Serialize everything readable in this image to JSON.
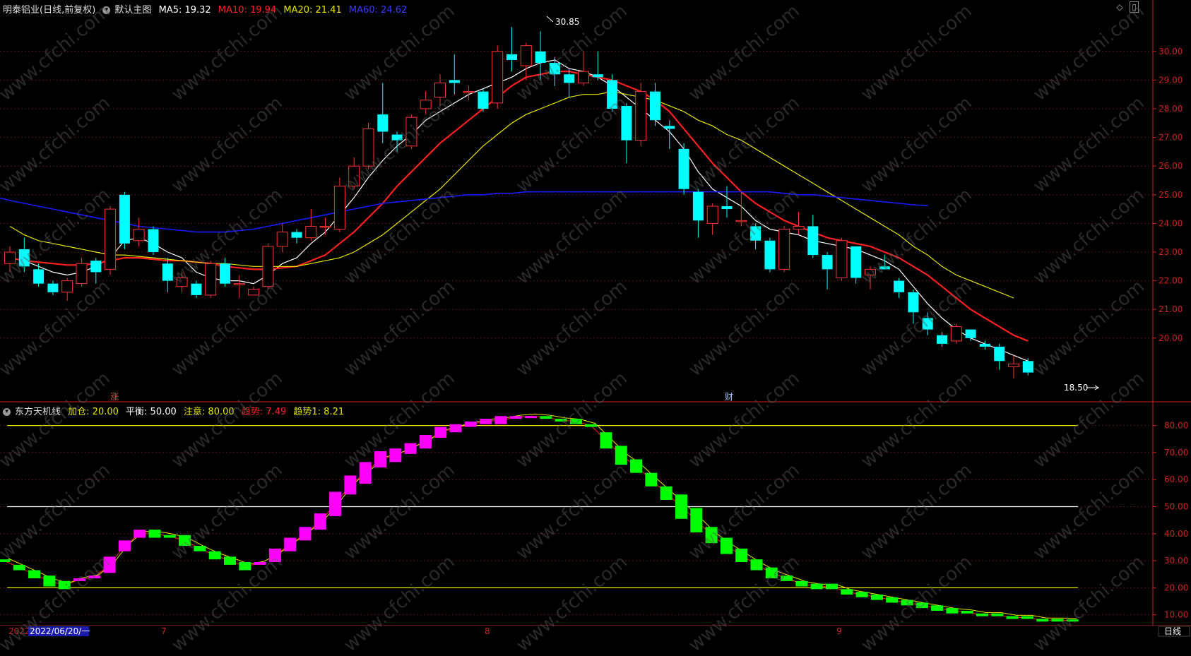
{
  "upper_header": {
    "title": "明泰铝业(日线,前复权)",
    "template": "默认主图",
    "ma5": "MA5: 19.32",
    "ma10": "MA10: 19.94",
    "ma20": "MA20: 21.41",
    "ma60": "MA60: 24.62"
  },
  "lower_header": {
    "title": "东方天机线",
    "jiacang": "加仓: 20.00",
    "pingheng": "平衡: 50.00",
    "zhuyi": "注意: 80.00",
    "qushi": "趋势: 7.49",
    "qushi1": "趋势1: 8.21"
  },
  "markers": {
    "zhang": "涨",
    "cai": "财",
    "high": "30.85",
    "low": "18.50"
  },
  "bottom_bar": {
    "year": "2022",
    "date": "2022/06/20/一",
    "m7": "7",
    "m8": "8",
    "m9": "9",
    "period": "日线"
  },
  "colors": {
    "up": "#ff3232",
    "down": "#00ffff",
    "ma5": "#ffffff",
    "ma10": "#ff2020",
    "ma20": "#e6e600",
    "ma60": "#1a1aff",
    "osc_up": "#ff00ff",
    "osc_down": "#00ff00",
    "axis": "#cc2222"
  },
  "chart_data": [
    {
      "type": "candlestick",
      "title": "明泰铝业(日线,前复权)",
      "y_ticks": [
        "20.00",
        "21.00",
        "22.00",
        "23.00",
        "24.00",
        "25.00",
        "26.00",
        "27.00",
        "28.00",
        "29.00",
        "30.00"
      ],
      "ylim": [
        18.0,
        31.3
      ],
      "candles": [
        {
          "o": 22.6,
          "c": 23.0,
          "h": 23.2,
          "l": 22.3
        },
        {
          "o": 23.1,
          "c": 22.5,
          "h": 23.5,
          "l": 22.3
        },
        {
          "o": 22.4,
          "c": 21.9,
          "h": 22.6,
          "l": 21.8
        },
        {
          "o": 21.9,
          "c": 21.6,
          "h": 22.0,
          "l": 21.5
        },
        {
          "o": 21.6,
          "c": 22.0,
          "h": 22.1,
          "l": 21.3
        },
        {
          "o": 21.9,
          "c": 22.6,
          "h": 22.8,
          "l": 21.8
        },
        {
          "o": 22.7,
          "c": 22.3,
          "h": 22.8,
          "l": 21.9
        },
        {
          "o": 22.4,
          "c": 24.5,
          "h": 24.6,
          "l": 22.2
        },
        {
          "o": 25.0,
          "c": 23.3,
          "h": 25.1,
          "l": 23.1
        },
        {
          "o": 23.4,
          "c": 23.8,
          "h": 24.2,
          "l": 23.2
        },
        {
          "o": 23.8,
          "c": 23.0,
          "h": 23.9,
          "l": 22.9
        },
        {
          "o": 22.6,
          "c": 22.0,
          "h": 22.8,
          "l": 21.6
        },
        {
          "o": 21.8,
          "c": 22.1,
          "h": 22.3,
          "l": 21.6
        },
        {
          "o": 21.9,
          "c": 21.5,
          "h": 22.0,
          "l": 21.4
        },
        {
          "o": 21.5,
          "c": 22.6,
          "h": 22.7,
          "l": 21.4
        },
        {
          "o": 22.6,
          "c": 21.9,
          "h": 22.8,
          "l": 21.8
        },
        {
          "o": 21.9,
          "c": 21.9,
          "h": 22.2,
          "l": 21.4
        },
        {
          "o": 21.5,
          "c": 21.7,
          "h": 21.8,
          "l": 21.5
        },
        {
          "o": 21.8,
          "c": 23.2,
          "h": 23.3,
          "l": 21.7
        },
        {
          "o": 23.2,
          "c": 23.7,
          "h": 24.0,
          "l": 23.0
        },
        {
          "o": 23.7,
          "c": 23.5,
          "h": 23.8,
          "l": 23.3
        },
        {
          "o": 23.5,
          "c": 23.9,
          "h": 24.5,
          "l": 23.4
        },
        {
          "o": 23.9,
          "c": 23.9,
          "h": 24.2,
          "l": 23.6
        },
        {
          "o": 23.8,
          "c": 25.3,
          "h": 25.6,
          "l": 23.7
        },
        {
          "o": 25.3,
          "c": 26.0,
          "h": 26.3,
          "l": 25.2
        },
        {
          "o": 26.0,
          "c": 27.3,
          "h": 27.5,
          "l": 25.9
        },
        {
          "o": 27.8,
          "c": 27.2,
          "h": 28.9,
          "l": 26.8
        },
        {
          "o": 27.1,
          "c": 26.9,
          "h": 27.2,
          "l": 26.5
        },
        {
          "o": 26.7,
          "c": 27.7,
          "h": 27.8,
          "l": 26.6
        },
        {
          "o": 28.0,
          "c": 28.3,
          "h": 28.6,
          "l": 27.8
        },
        {
          "o": 28.4,
          "c": 28.9,
          "h": 29.2,
          "l": 28.1
        },
        {
          "o": 29.0,
          "c": 28.9,
          "h": 29.9,
          "l": 28.5
        },
        {
          "o": 28.6,
          "c": 28.6,
          "h": 28.8,
          "l": 28.3
        },
        {
          "o": 28.6,
          "c": 28.0,
          "h": 28.7,
          "l": 27.9
        },
        {
          "o": 28.2,
          "c": 30.0,
          "h": 30.2,
          "l": 28.0
        },
        {
          "o": 29.9,
          "c": 29.7,
          "h": 30.85,
          "l": 29.3
        },
        {
          "o": 29.5,
          "c": 30.2,
          "h": 30.3,
          "l": 29.0
        },
        {
          "o": 30.0,
          "c": 29.6,
          "h": 30.7,
          "l": 29.0
        },
        {
          "o": 29.6,
          "c": 29.2,
          "h": 29.8,
          "l": 28.8
        },
        {
          "o": 29.2,
          "c": 28.9,
          "h": 29.4,
          "l": 28.4
        },
        {
          "o": 28.9,
          "c": 29.3,
          "h": 30.0,
          "l": 28.8
        },
        {
          "o": 29.2,
          "c": 29.1,
          "h": 30.0,
          "l": 29.0
        },
        {
          "o": 29.0,
          "c": 28.0,
          "h": 29.2,
          "l": 27.9
        },
        {
          "o": 28.1,
          "c": 26.9,
          "h": 28.2,
          "l": 26.1
        },
        {
          "o": 26.9,
          "c": 28.6,
          "h": 28.9,
          "l": 26.7
        },
        {
          "o": 28.6,
          "c": 27.6,
          "h": 28.9,
          "l": 27.4
        },
        {
          "o": 27.4,
          "c": 27.3,
          "h": 27.6,
          "l": 26.6
        },
        {
          "o": 26.6,
          "c": 25.2,
          "h": 26.8,
          "l": 25.0
        },
        {
          "o": 25.1,
          "c": 24.1,
          "h": 25.2,
          "l": 23.5
        },
        {
          "o": 24.0,
          "c": 24.6,
          "h": 24.7,
          "l": 23.6
        },
        {
          "o": 24.6,
          "c": 24.5,
          "h": 25.3,
          "l": 24.2
        },
        {
          "o": 24.1,
          "c": 24.1,
          "h": 25.1,
          "l": 23.9
        },
        {
          "o": 23.9,
          "c": 23.4,
          "h": 24.0,
          "l": 23.1
        },
        {
          "o": 23.4,
          "c": 22.4,
          "h": 23.5,
          "l": 22.3
        },
        {
          "o": 22.4,
          "c": 23.8,
          "h": 23.9,
          "l": 22.3
        },
        {
          "o": 23.8,
          "c": 23.9,
          "h": 24.4,
          "l": 23.6
        },
        {
          "o": 23.9,
          "c": 22.9,
          "h": 24.3,
          "l": 22.8
        },
        {
          "o": 22.9,
          "c": 22.4,
          "h": 23.0,
          "l": 21.7
        },
        {
          "o": 22.1,
          "c": 23.4,
          "h": 23.5,
          "l": 22.0
        },
        {
          "o": 23.2,
          "c": 22.1,
          "h": 23.2,
          "l": 21.9
        },
        {
          "o": 22.2,
          "c": 22.4,
          "h": 22.5,
          "l": 21.7
        },
        {
          "o": 22.5,
          "c": 22.4,
          "h": 22.9,
          "l": 22.4
        },
        {
          "o": 22.0,
          "c": 21.6,
          "h": 22.1,
          "l": 21.4
        },
        {
          "o": 21.6,
          "c": 20.9,
          "h": 21.7,
          "l": 20.5
        },
        {
          "o": 20.7,
          "c": 20.3,
          "h": 20.9,
          "l": 20.1
        },
        {
          "o": 20.1,
          "c": 19.8,
          "h": 20.2,
          "l": 19.7
        },
        {
          "o": 19.9,
          "c": 20.4,
          "h": 20.5,
          "l": 19.8
        },
        {
          "o": 20.3,
          "c": 20.0,
          "h": 20.3,
          "l": 19.9
        },
        {
          "o": 19.8,
          "c": 19.7,
          "h": 19.9,
          "l": 19.6
        },
        {
          "o": 19.7,
          "c": 19.2,
          "h": 19.8,
          "l": 18.9
        },
        {
          "o": 19.0,
          "c": 19.1,
          "h": 19.4,
          "l": 18.6
        },
        {
          "o": 19.2,
          "c": 18.8,
          "h": 19.3,
          "l": 18.7
        }
      ],
      "series": [
        {
          "name": "MA5",
          "values": [
            22.8,
            22.7,
            22.5,
            22.3,
            22.2,
            22.3,
            22.5,
            22.8,
            23.4,
            23.5,
            23.3,
            23.0,
            22.8,
            22.3,
            22.1,
            22.0,
            22.0,
            21.9,
            22.2,
            22.6,
            22.8,
            23.3,
            23.7,
            24.3,
            24.9,
            25.6,
            26.2,
            26.7,
            27.1,
            27.6,
            27.9,
            28.2,
            28.5,
            28.7,
            28.9,
            29.1,
            29.4,
            29.6,
            29.7,
            29.4,
            29.3,
            29.1,
            28.8,
            28.4,
            28.0,
            27.6,
            27.2,
            26.6,
            25.8,
            25.2,
            24.9,
            24.6,
            24.1,
            23.8,
            23.7,
            23.6,
            23.4,
            23.3,
            23.2,
            23.1,
            22.9,
            22.7,
            22.4,
            21.8,
            21.2,
            20.7,
            20.3,
            20.0,
            19.8,
            19.6,
            19.4,
            19.2
          ]
        },
        {
          "name": "MA10",
          "values": [
            22.8,
            22.7,
            22.65,
            22.6,
            22.55,
            22.55,
            22.6,
            22.7,
            22.8,
            22.8,
            22.75,
            22.7,
            22.7,
            22.65,
            22.6,
            22.5,
            22.45,
            22.4,
            22.4,
            22.45,
            22.5,
            22.7,
            22.9,
            23.3,
            23.7,
            24.2,
            24.7,
            25.3,
            25.8,
            26.3,
            26.8,
            27.2,
            27.6,
            28.0,
            28.4,
            28.8,
            29.1,
            29.2,
            29.3,
            29.3,
            29.2,
            29.1,
            29.0,
            28.8,
            28.6,
            28.3,
            27.9,
            27.3,
            26.7,
            26.1,
            25.6,
            25.1,
            24.7,
            24.4,
            24.1,
            23.9,
            23.7,
            23.5,
            23.4,
            23.3,
            23.2,
            23.0,
            22.8,
            22.5,
            22.2,
            21.8,
            21.4,
            21.0,
            20.7,
            20.4,
            20.1,
            19.9
          ]
        },
        {
          "name": "MA20",
          "values": [
            23.9,
            23.6,
            23.4,
            23.3,
            23.2,
            23.1,
            23.0,
            22.9,
            22.9,
            22.85,
            22.8,
            22.75,
            22.7,
            22.65,
            22.6,
            22.6,
            22.55,
            22.5,
            22.5,
            22.5,
            22.5,
            22.6,
            22.7,
            22.8,
            23.0,
            23.3,
            23.6,
            24.0,
            24.4,
            24.8,
            25.2,
            25.7,
            26.2,
            26.7,
            27.1,
            27.5,
            27.8,
            28.0,
            28.2,
            28.4,
            28.5,
            28.5,
            28.6,
            28.5,
            28.4,
            28.3,
            28.1,
            27.9,
            27.6,
            27.4,
            27.1,
            26.9,
            26.6,
            26.3,
            26.0,
            25.7,
            25.4,
            25.1,
            24.8,
            24.5,
            24.2,
            23.9,
            23.6,
            23.2,
            22.9,
            22.5,
            22.2,
            22.0,
            21.8,
            21.6,
            21.4
          ]
        },
        {
          "name": "MA60",
          "values": [
            25.2,
            25.1,
            25.0,
            24.9,
            24.8,
            24.7,
            24.6,
            24.5,
            24.4,
            24.3,
            24.2,
            24.1,
            24.0,
            23.9,
            23.85,
            23.8,
            23.75,
            23.7,
            23.7,
            23.7,
            23.75,
            23.8,
            23.9,
            24.0,
            24.1,
            24.2,
            24.3,
            24.4,
            24.5,
            24.6,
            24.7,
            24.75,
            24.8,
            24.85,
            24.9,
            24.95,
            25.0,
            25.0,
            25.05,
            25.05,
            25.1,
            25.1,
            25.1,
            25.1,
            25.1,
            25.1,
            25.1,
            25.1,
            25.1,
            25.1,
            25.1,
            25.1,
            25.1,
            25.1,
            25.1,
            25.1,
            25.1,
            25.1,
            25.05,
            25.0,
            25.0,
            24.95,
            24.9,
            24.85,
            24.8,
            24.75,
            24.7,
            24.65,
            24.62
          ]
        }
      ]
    },
    {
      "type": "bar",
      "title": "东方天机线",
      "y_ticks": [
        "10.00",
        "20.00",
        "30.00",
        "40.00",
        "50.00",
        "60.00",
        "70.00",
        "80.00"
      ],
      "ylim": [
        6,
        88
      ],
      "ref_lines": [
        20,
        50,
        80
      ],
      "values": [
        [
          29.5,
          30.5
        ],
        [
          26.5,
          28.5
        ],
        [
          23.5,
          26.5
        ],
        [
          20.5,
          24.5
        ],
        [
          19.5,
          22.5
        ],
        [
          22.5,
          23.5
        ],
        [
          23.5,
          24.5
        ],
        [
          25.5,
          31.5
        ],
        [
          33.5,
          37.5
        ],
        [
          38.5,
          41.5
        ],
        [
          38.5,
          41.5
        ],
        [
          38.5,
          39.5
        ],
        [
          35.5,
          39.5
        ],
        [
          33.5,
          35.5
        ],
        [
          30.5,
          33.5
        ],
        [
          28.5,
          31.5
        ],
        [
          26.5,
          29.5
        ],
        [
          28.5,
          29.5
        ],
        [
          29.5,
          34.5
        ],
        [
          33.5,
          38.5
        ],
        [
          37.5,
          42.5
        ],
        [
          41.5,
          47.5
        ],
        [
          46.5,
          55.5
        ],
        [
          54.5,
          61.5
        ],
        [
          58.5,
          66.5
        ],
        [
          64.5,
          70.5
        ],
        [
          66.5,
          71.5
        ],
        [
          69.5,
          73.5
        ],
        [
          71.5,
          76.5
        ],
        [
          75.5,
          79.5
        ],
        [
          77.5,
          80.5
        ],
        [
          79.5,
          81.5
        ],
        [
          80.5,
          82.5
        ],
        [
          80.5,
          83.5
        ],
        [
          82.5,
          83.5
        ],
        [
          83.5,
          83.5
        ],
        [
          82.5,
          83.5
        ],
        [
          81.5,
          82.5
        ],
        [
          80.5,
          82.5
        ],
        [
          79.5,
          80.5
        ],
        [
          71.5,
          77.5
        ],
        [
          65.5,
          72.5
        ],
        [
          62.5,
          67.5
        ],
        [
          57.5,
          62.5
        ],
        [
          52.5,
          57.5
        ],
        [
          45.5,
          54.5
        ],
        [
          40.5,
          49.5
        ],
        [
          36.5,
          42.5
        ],
        [
          32.5,
          38.5
        ],
        [
          29.5,
          34.5
        ],
        [
          26.5,
          30.5
        ],
        [
          23.5,
          27.5
        ],
        [
          22.5,
          24.5
        ],
        [
          20.5,
          22.5
        ],
        [
          19.5,
          21.5
        ],
        [
          19.5,
          21.5
        ],
        [
          17.5,
          19.5
        ],
        [
          16.5,
          18.5
        ],
        [
          15.5,
          17.5
        ],
        [
          14.5,
          16.5
        ],
        [
          13.5,
          15.5
        ],
        [
          12.5,
          14.5
        ],
        [
          11.5,
          13.5
        ],
        [
          10.5,
          12.5
        ],
        [
          10.5,
          11.5
        ],
        [
          9.5,
          10.5
        ],
        [
          9.5,
          10.5
        ],
        [
          8.5,
          9.5
        ],
        [
          8.5,
          9.5
        ],
        [
          7.5,
          8.5
        ],
        [
          7.5,
          8.5
        ],
        [
          7.5,
          8.3
        ]
      ]
    }
  ]
}
